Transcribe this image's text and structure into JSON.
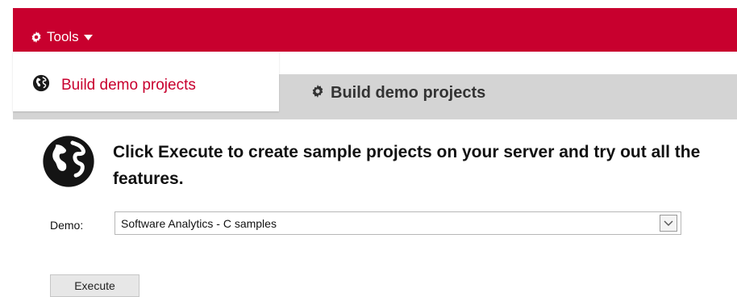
{
  "header": {
    "tools_label": "Tools",
    "tools_icon": "gear-icon",
    "dropdown_icon": "caret-down-icon"
  },
  "menu": {
    "items": [
      {
        "label": "Build demo projects",
        "icon": "globe-icon"
      }
    ]
  },
  "page": {
    "title": "Build demo projects",
    "title_icon": "gear-icon",
    "instructions": "Click Execute to create sample projects on your server and try out all the features.",
    "instructions_icon": "globe-icon"
  },
  "form": {
    "demo_label": "Demo:",
    "demo_selected": "Software Analytics - C samples",
    "execute_label": "Execute"
  },
  "colors": {
    "brand_red": "#c8002e",
    "grey_band": "#d4d4d4"
  }
}
